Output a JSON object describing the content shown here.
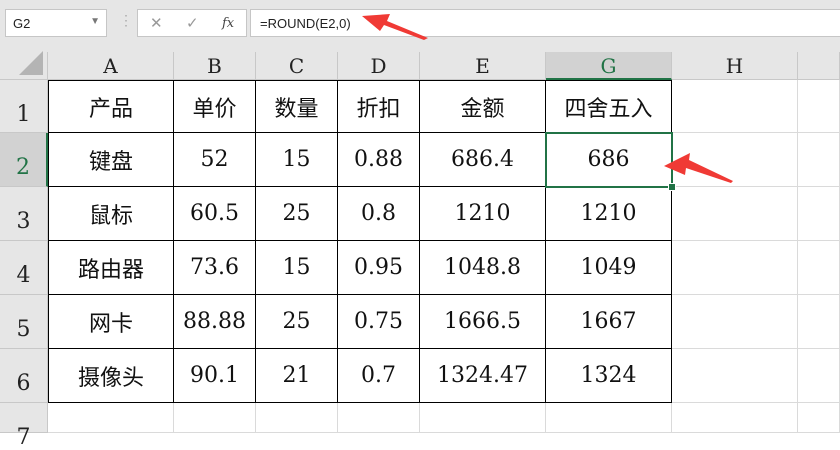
{
  "toolbar": {
    "name_box": "G2",
    "cancel_icon": "✕",
    "enter_icon": "✓",
    "fx_label": "fx",
    "formula": "=ROUND(E2,0)"
  },
  "columns": [
    "A",
    "B",
    "C",
    "D",
    "E",
    "G",
    "H"
  ],
  "rows": [
    "1",
    "2",
    "3",
    "4",
    "5",
    "6",
    "7"
  ],
  "table": {
    "headers": [
      "产品",
      "单价",
      "数量",
      "折扣",
      "金额",
      "四舍五入"
    ],
    "data": [
      [
        "键盘",
        "52",
        "15",
        "0.88",
        "686.4",
        "686"
      ],
      [
        "鼠标",
        "60.5",
        "25",
        "0.8",
        "1210",
        "1210"
      ],
      [
        "路由器",
        "73.6",
        "15",
        "0.95",
        "1048.8",
        "1049"
      ],
      [
        "网卡",
        "88.88",
        "25",
        "0.75",
        "1666.5",
        "1667"
      ],
      [
        "摄像头",
        "90.1",
        "21",
        "0.7",
        "1324.47",
        "1324"
      ]
    ]
  },
  "selected_cell": "G2",
  "colors": {
    "accent": "#217346",
    "arrow": "#f03a35"
  }
}
